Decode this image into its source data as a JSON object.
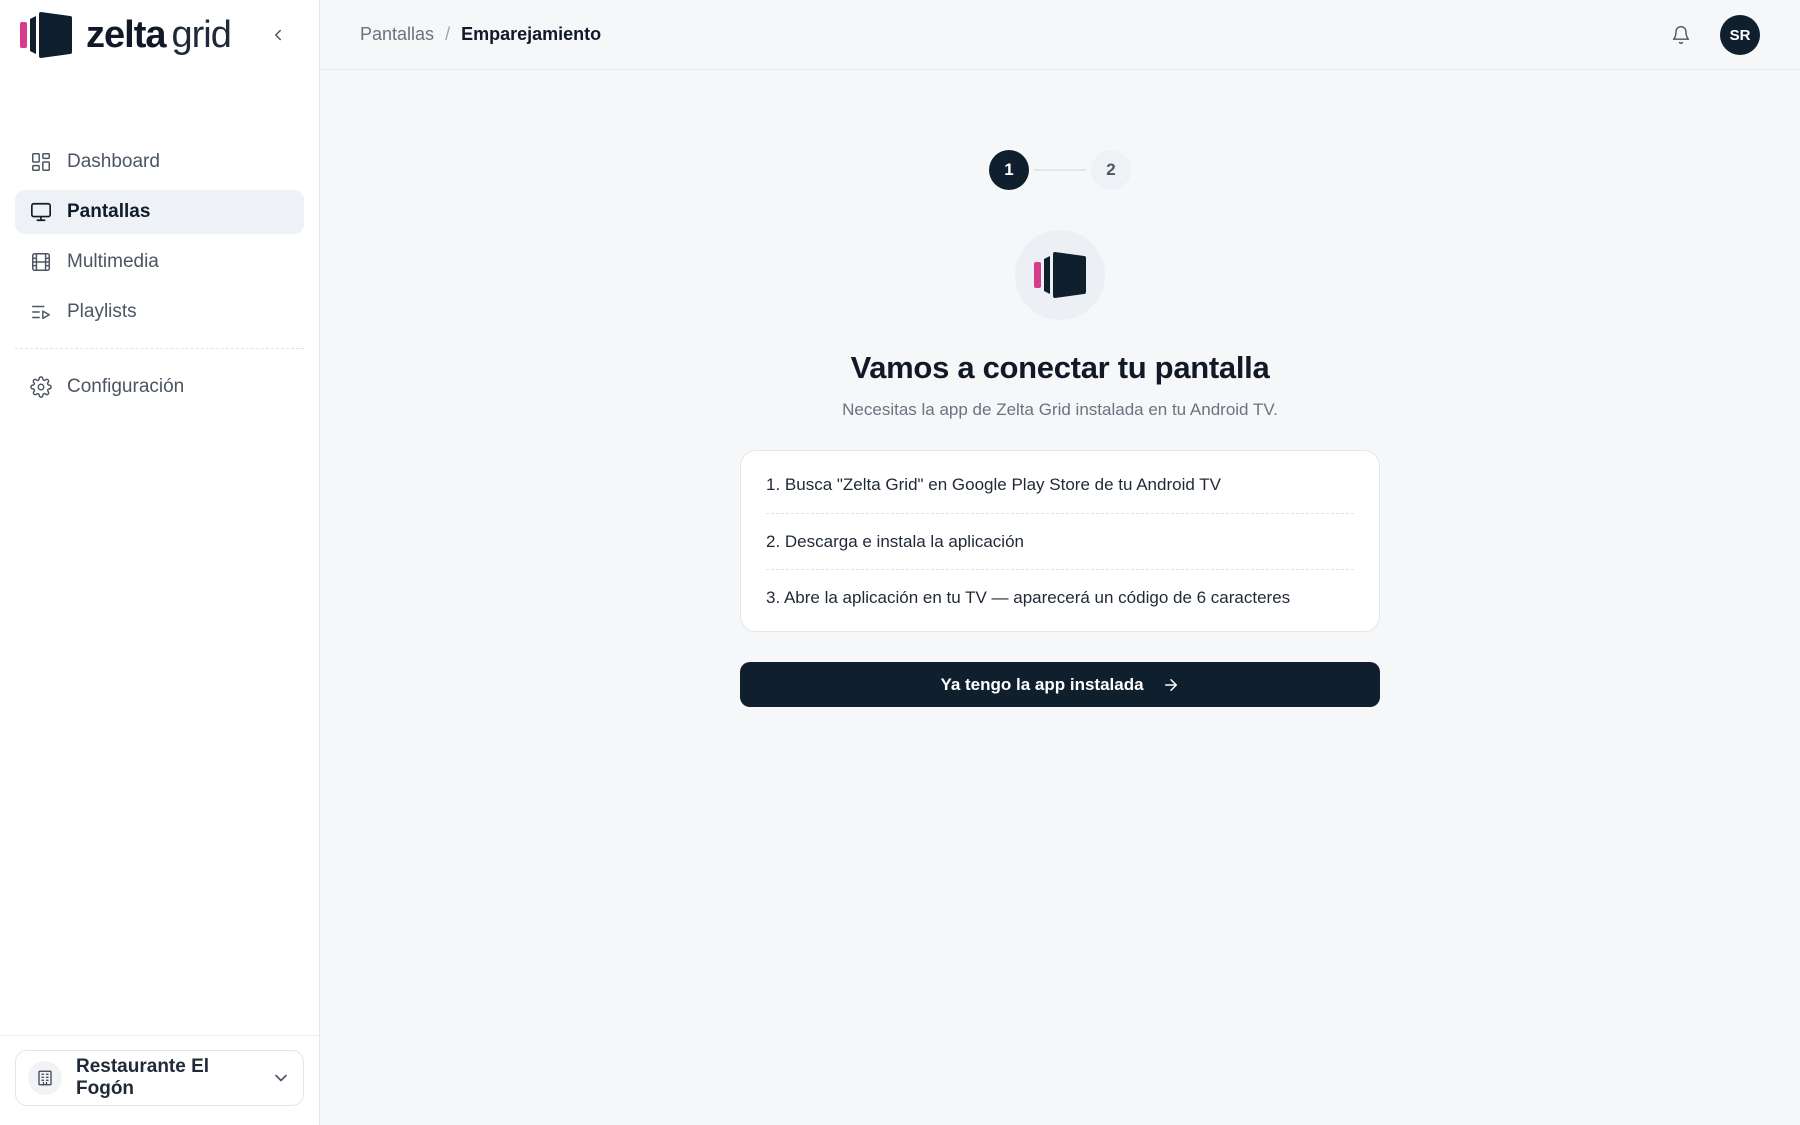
{
  "brand": {
    "name_bold": "zelta",
    "name_light": "grid",
    "colors": {
      "primary": "#0f1f2e",
      "accent": "#d63c8a"
    }
  },
  "sidebar": {
    "items": [
      {
        "label": "Dashboard",
        "icon": "dashboard-icon",
        "active": false
      },
      {
        "label": "Pantallas",
        "icon": "monitor-icon",
        "active": true
      },
      {
        "label": "Multimedia",
        "icon": "film-icon",
        "active": false
      },
      {
        "label": "Playlists",
        "icon": "playlist-icon",
        "active": false
      }
    ],
    "settings": {
      "label": "Configuración",
      "icon": "gear-icon"
    },
    "org": {
      "name": "Restaurante El Fogón",
      "icon": "building-icon"
    }
  },
  "header": {
    "breadcrumb": {
      "parent": "Pantallas",
      "separator": "/",
      "current": "Emparejamiento"
    },
    "avatar_initials": "SR"
  },
  "pairing": {
    "steps": [
      "1",
      "2"
    ],
    "current_step": 1,
    "title": "Vamos a conectar tu pantalla",
    "subtitle": "Necesitas la app de Zelta Grid instalada en tu Android TV.",
    "instructions": [
      "1. Busca \"Zelta Grid\" en Google Play Store de tu Android TV",
      "2. Descarga e instala la aplicación",
      "3. Abre la aplicación en tu TV — aparecerá un código de 6 caracteres"
    ],
    "cta_label": "Ya tengo la app instalada"
  }
}
